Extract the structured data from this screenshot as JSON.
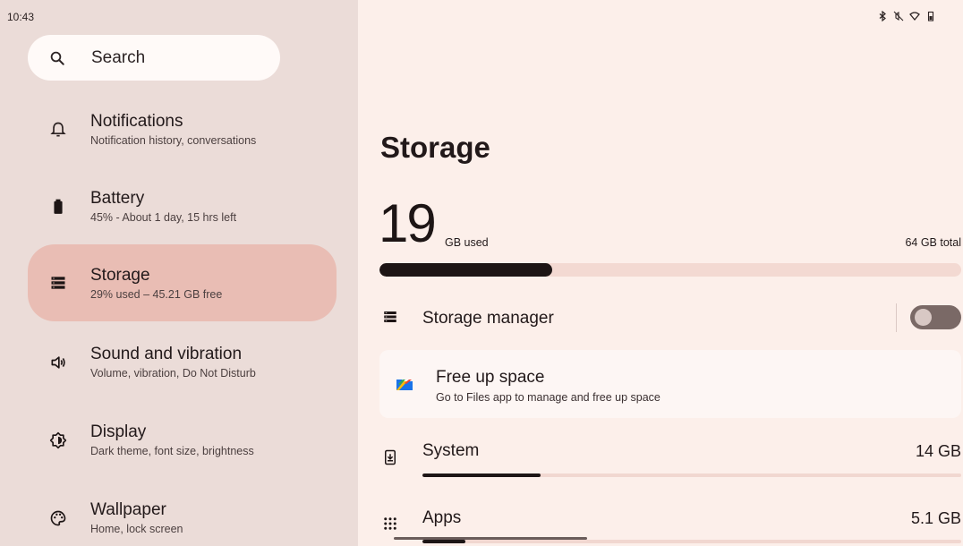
{
  "status_bar": {
    "time": "10:43",
    "icons": [
      "bluetooth-icon",
      "mute-icon",
      "wifi-icon",
      "battery-icon"
    ]
  },
  "sidebar": {
    "search_label": "Search",
    "items": [
      {
        "icon": "bell-icon",
        "title": "Notifications",
        "subtitle": "Notification history, conversations",
        "selected": false
      },
      {
        "icon": "battery-icon",
        "title": "Battery",
        "subtitle": "45% - About 1 day, 15 hrs left",
        "selected": false
      },
      {
        "icon": "storage-icon",
        "title": "Storage",
        "subtitle": "29% used – 45.21 GB free",
        "selected": true
      },
      {
        "icon": "speaker-icon",
        "title": "Sound and vibration",
        "subtitle": "Volume, vibration, Do Not Disturb",
        "selected": false
      },
      {
        "icon": "brightness-icon",
        "title": "Display",
        "subtitle": "Dark theme, font size, brightness",
        "selected": false
      },
      {
        "icon": "palette-icon",
        "title": "Wallpaper",
        "subtitle": "Home, lock screen",
        "selected": false
      }
    ]
  },
  "main": {
    "title": "Storage",
    "used_number": "19",
    "used_unit": "GB used",
    "total": "64 GB total",
    "used_fraction": 0.297,
    "storage_manager": {
      "label": "Storage manager",
      "enabled": false
    },
    "free_up": {
      "title": "Free up space",
      "subtitle": "Go to Files app to manage and free up space"
    },
    "categories": [
      {
        "icon": "system-update-icon",
        "label": "System",
        "size": "14 GB",
        "fraction": 0.22
      },
      {
        "icon": "apps-grid-icon",
        "label": "Apps",
        "size": "5.1 GB",
        "fraction": 0.08
      }
    ]
  },
  "colors": {
    "left_bg": "#ebdcd8",
    "right_bg": "#fcefea",
    "selected_bg": "#e9bdb4",
    "accent_dark": "#1d1515"
  }
}
